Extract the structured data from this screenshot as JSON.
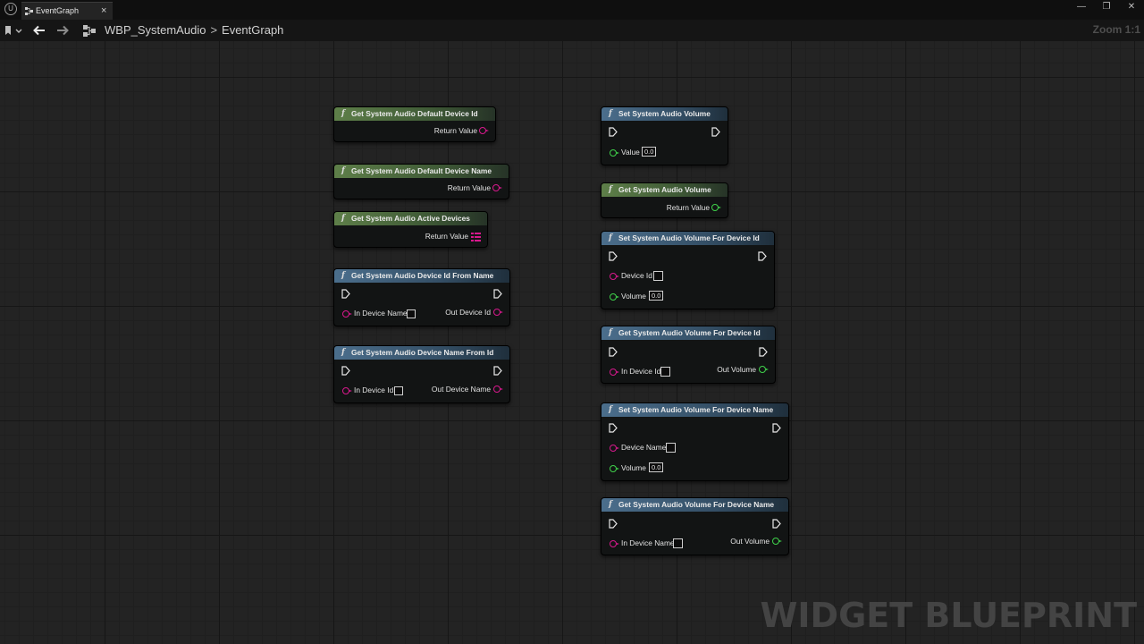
{
  "window": {
    "tab_label": "EventGraph",
    "tab_close": "×",
    "minimize": "—",
    "restore": "❐",
    "close": "✕"
  },
  "toolbar": {
    "breadcrumb_root": "WBP_SystemAudio",
    "breadcrumb_sep": ">",
    "breadcrumb_current": "EventGraph",
    "zoom": "Zoom 1:1"
  },
  "watermark": "WIDGET BLUEPRINT",
  "colors": {
    "pure_header": "#5e7f49",
    "impure_header": "#4b6e8c",
    "string_pin": "#d8188d",
    "float_pin": "#3fd14a",
    "canvas": "#232323"
  },
  "nodes": {
    "get_default_id": {
      "title": "Get System Audio Default Device Id",
      "fn": "f",
      "return_label": "Return Value"
    },
    "get_default_name": {
      "title": "Get System Audio Default Device Name",
      "fn": "f",
      "return_label": "Return Value"
    },
    "get_active": {
      "title": "Get System Audio Active Devices",
      "fn": "f",
      "return_label": "Return Value"
    },
    "get_id_from_name": {
      "title": "Get System Audio Device Id From Name",
      "fn": "f",
      "in_label": "In Device Name",
      "out_label": "Out Device Id"
    },
    "get_name_from_id": {
      "title": "Get System Audio Device Name From Id",
      "fn": "f",
      "in_label": "In Device Id",
      "out_label": "Out Device Name"
    },
    "set_volume": {
      "title": "Set System Audio Volume",
      "fn": "f",
      "value_label": "Value",
      "value": "0.0"
    },
    "get_volume": {
      "title": "Get System Audio Volume",
      "fn": "f",
      "return_label": "Return Value"
    },
    "set_volume_id": {
      "title": "Set System Audio Volume For Device Id",
      "fn": "f",
      "device_label": "Device Id",
      "volume_label": "Volume",
      "volume": "0.0"
    },
    "get_volume_id": {
      "title": "Get System Audio Volume For Device Id",
      "fn": "f",
      "in_label": "In Device Id",
      "out_label": "Out Volume"
    },
    "set_volume_name": {
      "title": "Set System Audio Volume For Device Name",
      "fn": "f",
      "device_label": "Device Name",
      "volume_label": "Volume",
      "volume": "0.0"
    },
    "get_volume_name": {
      "title": "Get System Audio Volume For Device Name",
      "fn": "f",
      "in_label": "In Device Name",
      "out_label": "Out Volume"
    }
  }
}
